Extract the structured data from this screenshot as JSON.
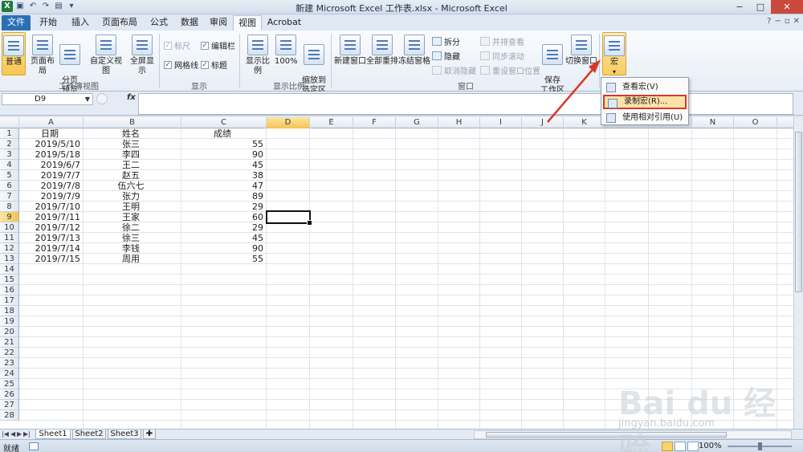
{
  "window": {
    "title": "新建 Microsoft Excel 工作表.xlsx - Microsoft Excel",
    "controls": [
      "−",
      "□",
      "✕"
    ]
  },
  "tabs": [
    "文件",
    "开始",
    "插入",
    "页面布局",
    "公式",
    "数据",
    "审阅",
    "视图",
    "Acrobat"
  ],
  "active_tab": "视图",
  "ribbon": {
    "groups": {
      "workbook_views": {
        "label": "工作簿视图",
        "buttons": [
          "普通",
          "页面布局",
          "分页\n预览",
          "自定义视图",
          "全屏显示"
        ]
      },
      "show": {
        "label": "显示",
        "checks": [
          {
            "label": "标尺",
            "checked": true,
            "disabled": true
          },
          {
            "label": "编辑栏",
            "checked": true,
            "disabled": false
          },
          {
            "label": "网格线",
            "checked": true,
            "disabled": false
          },
          {
            "label": "标题",
            "checked": true,
            "disabled": false
          }
        ]
      },
      "zoom": {
        "label": "显示比例",
        "buttons": [
          "显示比例",
          "100%",
          "缩放到\n选定区域"
        ]
      },
      "window": {
        "label": "窗口",
        "buttons": [
          "新建窗口",
          "全部重排",
          "冻结窗格"
        ],
        "small": [
          {
            "label": "拆分",
            "disabled": false
          },
          {
            "label": "隐藏",
            "disabled": false
          },
          {
            "label": "取消隐藏",
            "disabled": true
          },
          {
            "label": "并排查看",
            "disabled": true
          },
          {
            "label": "同步滚动",
            "disabled": true
          },
          {
            "label": "重设窗口位置",
            "disabled": true
          }
        ],
        "big2": [
          "保存\n工作区",
          "切换窗口"
        ]
      },
      "macros": {
        "label": "宏"
      }
    }
  },
  "macro_menu": [
    "查看宏(V)",
    "录制宏(R)...",
    "使用相对引用(U)"
  ],
  "formula_bar": {
    "name_box": "D9",
    "fx": "fx",
    "value": ""
  },
  "columns": [
    "A",
    "B",
    "C",
    "D",
    "E",
    "F",
    "G",
    "H",
    "I",
    "J",
    "K",
    "L",
    "M",
    "N",
    "O"
  ],
  "rows": [
    "1",
    "2",
    "3",
    "4",
    "5",
    "6",
    "7",
    "8",
    "9",
    "10",
    "11",
    "12",
    "13",
    "14",
    "15",
    "16",
    "17",
    "18",
    "19",
    "20",
    "21",
    "22",
    "23",
    "24",
    "25",
    "26",
    "27",
    "28"
  ],
  "table": {
    "headers": [
      "日期",
      "姓名",
      "成绩"
    ],
    "rows": [
      [
        "2019/5/10",
        "张三",
        "55"
      ],
      [
        "2019/5/18",
        "李四",
        "90"
      ],
      [
        "2019/6/7",
        "王二",
        "45"
      ],
      [
        "2019/7/7",
        "赵五",
        "38"
      ],
      [
        "2019/7/8",
        "伍六七",
        "47"
      ],
      [
        "2019/7/9",
        "张力",
        "89"
      ],
      [
        "2019/7/10",
        "王明",
        "29"
      ],
      [
        "2019/7/11",
        "王家",
        "60"
      ],
      [
        "2019/7/12",
        "徐二",
        "29"
      ],
      [
        "2019/7/13",
        "徐三",
        "45"
      ],
      [
        "2019/7/14",
        "李钱",
        "90"
      ],
      [
        "2019/7/15",
        "周用",
        "55"
      ]
    ]
  },
  "selected_cell": "D9",
  "sheets": [
    "Sheet1",
    "Sheet2",
    "Sheet3"
  ],
  "active_sheet": "Sheet1",
  "status": {
    "text": "就绪",
    "zoom": "100%"
  },
  "watermark": {
    "logo": "Bai du 经验",
    "url": "jingyan.baidu.com"
  },
  "colors": {
    "file_tab": "#2a6fb5",
    "selection_header": "#f6c24f",
    "annotation": "#d9372b"
  }
}
